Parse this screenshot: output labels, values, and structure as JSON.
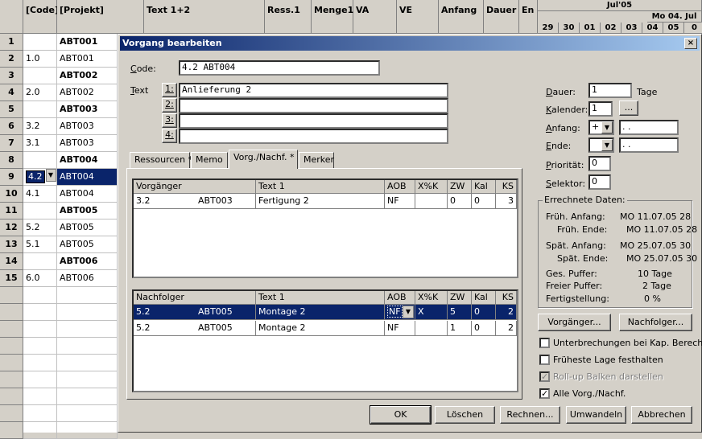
{
  "sheet": {
    "columns": [
      "[Code]",
      "[Projekt]",
      "Text 1+2",
      "Ress.1",
      "Menge1",
      "VA",
      "VE",
      "Anfang",
      "Dauer",
      "En"
    ],
    "gantt": {
      "month": "Jul'05",
      "week": "Mo 04. Jul",
      "days": [
        "29",
        "30",
        "01",
        "02",
        "03",
        "04",
        "05",
        "0"
      ]
    },
    "rows": [
      {
        "num": "1",
        "code": "",
        "projekt": "ABT001",
        "bold": true
      },
      {
        "num": "2",
        "code": "1.0",
        "projekt": "ABT001",
        "bold": false
      },
      {
        "num": "3",
        "code": "",
        "projekt": "ABT002",
        "bold": true
      },
      {
        "num": "4",
        "code": "2.0",
        "projekt": "ABT002",
        "bold": false
      },
      {
        "num": "5",
        "code": "",
        "projekt": "ABT003",
        "bold": true
      },
      {
        "num": "6",
        "code": "3.2",
        "projekt": "ABT003",
        "bold": false
      },
      {
        "num": "7",
        "code": "3.1",
        "projekt": "ABT003",
        "bold": false
      },
      {
        "num": "8",
        "code": "",
        "projekt": "ABT004",
        "bold": true
      },
      {
        "num": "9",
        "code": "4.2",
        "projekt": "ABT004",
        "bold": false,
        "selected": true
      },
      {
        "num": "10",
        "code": "4.1",
        "projekt": "ABT004",
        "bold": false
      },
      {
        "num": "11",
        "code": "",
        "projekt": "ABT005",
        "bold": true
      },
      {
        "num": "12",
        "code": "5.2",
        "projekt": "ABT005",
        "bold": false
      },
      {
        "num": "13",
        "code": "5.1",
        "projekt": "ABT005",
        "bold": false
      },
      {
        "num": "14",
        "code": "",
        "projekt": "ABT006",
        "bold": true
      },
      {
        "num": "15",
        "code": "6.0",
        "projekt": "ABT006",
        "bold": false
      }
    ]
  },
  "dialog": {
    "title": "Vorgang bearbeiten",
    "close_label": "×",
    "code_label": "Code:",
    "code_value": "4.2                 ABT004",
    "text_label": "Text",
    "text_lines": [
      {
        "btn": "1:",
        "value": "Anlieferung 2"
      },
      {
        "btn": "2:",
        "value": ""
      },
      {
        "btn": "3:",
        "value": ""
      },
      {
        "btn": "4:",
        "value": ""
      }
    ],
    "tabs": [
      "Ressourcen *",
      "Memo",
      "Vorg./Nachf. *",
      "Merker"
    ],
    "active_tab": 2,
    "predecessors": {
      "headers": [
        "Vorgänger",
        "Text 1",
        "AOB",
        "X%K",
        "ZW",
        "Kal",
        "KS"
      ],
      "rows": [
        {
          "code": "3.2",
          "proj": "ABT003",
          "text": "Fertigung 2",
          "aob": "NF",
          "xk": "",
          "zw": "0",
          "kal": "0",
          "ks": "3"
        }
      ]
    },
    "successors": {
      "headers": [
        "Nachfolger",
        "Text 1",
        "AOB",
        "X%K",
        "ZW",
        "Kal",
        "KS"
      ],
      "rows": [
        {
          "code": "5.2",
          "proj": "ABT005",
          "text": "Montage 2",
          "aob": "NF",
          "xk": "X",
          "zw": "5",
          "kal": "0",
          "ks": "2",
          "selected": true
        },
        {
          "code": "5.2",
          "proj": "ABT005",
          "text": "Montage 2",
          "aob": "NF",
          "xk": "",
          "zw": "1",
          "kal": "0",
          "ks": "2"
        }
      ]
    },
    "fields": {
      "dauer_label": "Dauer:",
      "dauer_value": "1",
      "dauer_unit": "Tage",
      "kalender_label": "Kalender:",
      "kalender_value": "1",
      "kalender_btn": "...",
      "anfang_label": "Anfang:",
      "anfang_sign": "+",
      "anfang_value": " . .",
      "ende_label": "Ende:",
      "ende_sign": "",
      "ende_value": " . .",
      "prioritaet_label": "Priorität:",
      "prioritaet_value": "0",
      "selektor_label": "Selektor:",
      "selektor_value": "0"
    },
    "computed": {
      "title": "Errechnete Daten:",
      "items": [
        {
          "label": "Früh. Anfang:",
          "value": "MO 11.07.05 28"
        },
        {
          "label": "Früh. Ende:",
          "value": "MO 11.07.05 28"
        },
        {
          "label": "Spät. Anfang:",
          "value": "MO 25.07.05 30"
        },
        {
          "label": "Spät. Ende:",
          "value": "MO 25.07.05 30"
        },
        {
          "label": "Ges. Puffer:",
          "value": "10 Tage"
        },
        {
          "label": "Freier Puffer:",
          "value": "2 Tage"
        },
        {
          "label": "Fertigstellung:",
          "value": "0 %"
        }
      ]
    },
    "vorgaenger_btn": "Vorgänger...",
    "nachfolger_btn": "Nachfolger...",
    "checkboxes": [
      {
        "label": "Unterbrechungen bei Kap. Berechng.",
        "checked": false,
        "disabled": false
      },
      {
        "label": "Früheste Lage festhalten",
        "checked": false,
        "disabled": false
      },
      {
        "label": "Roll-up Balken darstellen",
        "checked": true,
        "disabled": true
      },
      {
        "label": "Alle Vorg./Nachf.",
        "checked": true,
        "disabled": false
      }
    ],
    "buttons": [
      "OK",
      "Löschen",
      "Rechnen...",
      "Umwandeln",
      "Abbrechen"
    ]
  }
}
